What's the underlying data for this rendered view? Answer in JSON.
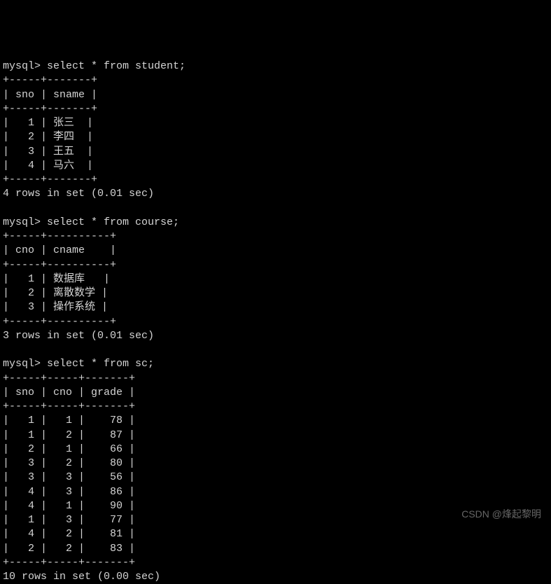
{
  "chart_data": [
    {
      "type": "table",
      "title": "student",
      "columns": [
        "sno",
        "sname"
      ],
      "rows": [
        [
          1,
          "张三"
        ],
        [
          2,
          "李四"
        ],
        [
          3,
          "王五"
        ],
        [
          4,
          "马六"
        ]
      ]
    },
    {
      "type": "table",
      "title": "course",
      "columns": [
        "cno",
        "cname"
      ],
      "rows": [
        [
          1,
          "数据库"
        ],
        [
          2,
          "离散数学"
        ],
        [
          3,
          "操作系统"
        ]
      ]
    },
    {
      "type": "table",
      "title": "sc",
      "columns": [
        "sno",
        "cno",
        "grade"
      ],
      "rows": [
        [
          1,
          1,
          78
        ],
        [
          1,
          2,
          87
        ],
        [
          2,
          1,
          66
        ],
        [
          3,
          2,
          80
        ],
        [
          3,
          3,
          56
        ],
        [
          4,
          3,
          86
        ],
        [
          4,
          1,
          90
        ],
        [
          1,
          3,
          77
        ],
        [
          4,
          2,
          81
        ],
        [
          2,
          2,
          83
        ]
      ]
    }
  ],
  "queries": [
    {
      "prompt": "mysql> ",
      "command": "select * from student;",
      "border1": "+-----+-------+",
      "header": "| sno | sname |",
      "border2": "+-----+-------+",
      "rows": [
        "|   1 | 张三  |",
        "|   2 | 李四  |",
        "|   3 | 王五  |",
        "|   4 | 马六  |"
      ],
      "border3": "+-----+-------+",
      "footer": "4 rows in set (0.01 sec)"
    },
    {
      "prompt": "mysql> ",
      "command": "select * from course;",
      "border1": "+-----+----------+",
      "header": "| cno | cname    |",
      "border2": "+-----+----------+",
      "rows": [
        "|   1 | 数据库   |",
        "|   2 | 离散数学 |",
        "|   3 | 操作系统 |"
      ],
      "border3": "+-----+----------+",
      "footer": "3 rows in set (0.01 sec)"
    },
    {
      "prompt": "mysql> ",
      "command": "select * from sc;",
      "border1": "+-----+-----+-------+",
      "header": "| sno | cno | grade |",
      "border2": "+-----+-----+-------+",
      "rows": [
        "|   1 |   1 |    78 |",
        "|   1 |   2 |    87 |",
        "|   2 |   1 |    66 |",
        "|   3 |   2 |    80 |",
        "|   3 |   3 |    56 |",
        "|   4 |   3 |    86 |",
        "|   4 |   1 |    90 |",
        "|   1 |   3 |    77 |",
        "|   4 |   2 |    81 |",
        "|   2 |   2 |    83 |"
      ],
      "border3": "+-----+-----+-------+",
      "footer": "10 rows in set (0.00 sec)"
    }
  ],
  "watermark": "CSDN @烽起黎明"
}
